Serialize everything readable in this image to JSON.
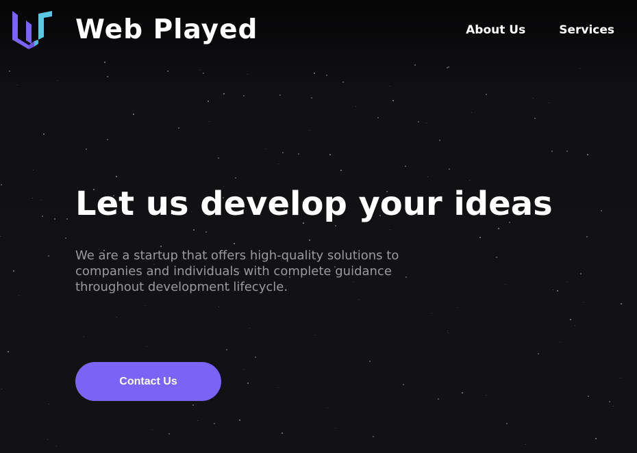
{
  "brand": {
    "name": "Web Played",
    "logo_icon": "w-logo-icon",
    "logo_colors": [
      "#7b63f6",
      "#5ac8e0"
    ]
  },
  "nav": {
    "items": [
      {
        "label": "About Us"
      },
      {
        "label": "Services"
      }
    ]
  },
  "hero": {
    "title": "Let us develop your ideas",
    "subtitle": "We are a startup that offers high-quality solutions to companies and individuals with complete guidance throughout development lifecycle.",
    "cta_label": "Contact Us"
  },
  "colors": {
    "background": "#111113",
    "accent": "#7b63f6",
    "text_primary": "#ffffff",
    "text_secondary": "#9a9a9f"
  }
}
